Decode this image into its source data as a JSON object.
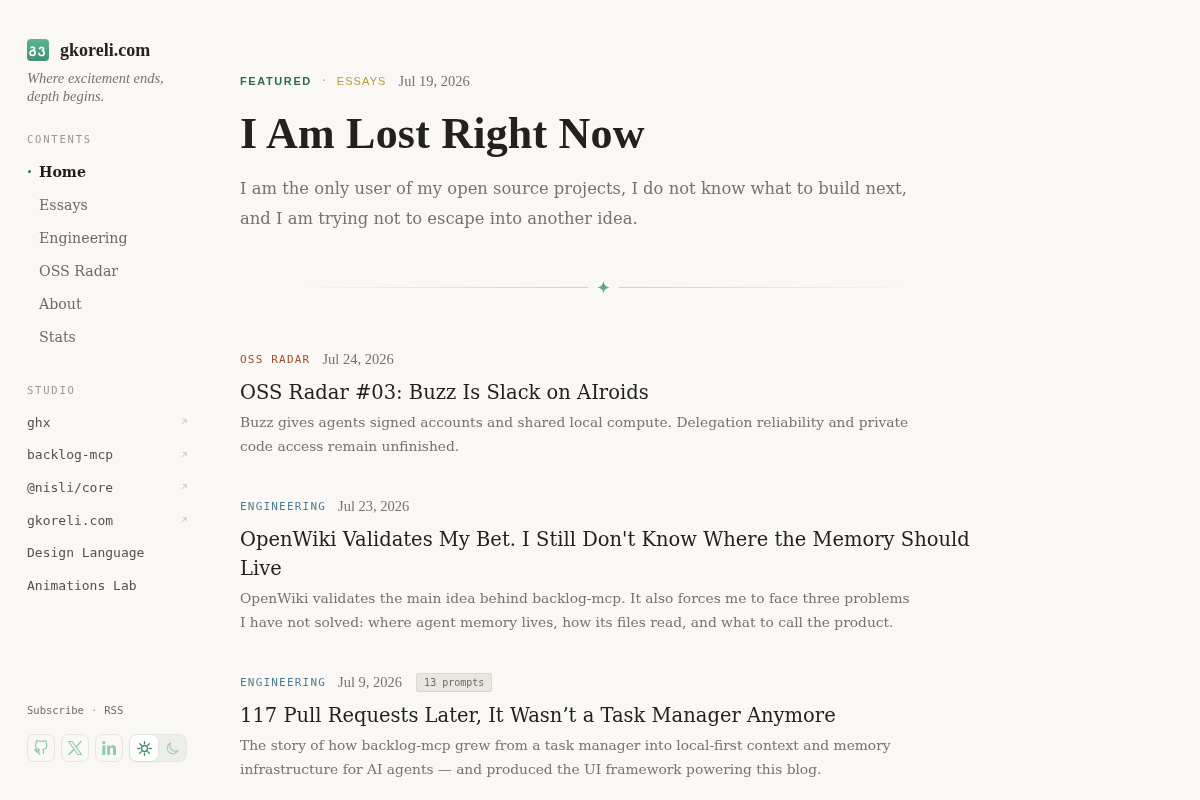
{
  "site": {
    "name": "gkoreli.com",
    "tagline": "Where excitement ends, depth begins."
  },
  "contents": {
    "heading": "CONTENTS",
    "items": [
      {
        "label": "Home",
        "selected": true
      },
      {
        "label": "Essays",
        "selected": false
      },
      {
        "label": "Engineering",
        "selected": false
      },
      {
        "label": "OSS Radar",
        "selected": false
      },
      {
        "label": "About",
        "selected": false
      },
      {
        "label": "Stats",
        "selected": false
      }
    ]
  },
  "studio": {
    "heading": "STUDIO",
    "items": [
      {
        "label": "ghx",
        "external": true
      },
      {
        "label": "backlog-mcp",
        "external": true
      },
      {
        "label": "@nisli/core",
        "external": true
      },
      {
        "label": "gkoreli.com",
        "external": true
      },
      {
        "label": "Design Language",
        "external": false
      },
      {
        "label": "Animations Lab",
        "external": false
      }
    ]
  },
  "footer": {
    "links": [
      "Subscribe",
      "RSS"
    ],
    "separator": "·"
  },
  "social": [
    {
      "kind": "github"
    },
    {
      "kind": "x"
    },
    {
      "kind": "linkedin"
    }
  ],
  "theme_toggle": [
    {
      "kind": "light",
      "selected": true
    },
    {
      "kind": "dark",
      "selected": false
    }
  ],
  "featured": {
    "label": "FEATURED",
    "separator": "·",
    "category": "ESSAYS",
    "date": "Jul 19, 2026",
    "title": "I Am Lost Right Now",
    "summary": "I am the only user of my open source projects, I do not know what to build next, and I am trying not to escape into another idea."
  },
  "posts": [
    {
      "category": "OSS RADAR",
      "color": "#a34b2e",
      "date": "Jul 24, 2026",
      "title": "OSS Radar #03: Buzz Is Slack on AIroids",
      "excerpt": "Buzz gives agents signed accounts and shared local compute. Delegation reliability and private code access remain unfinished."
    },
    {
      "category": "ENGINEERING",
      "color": "#4f7d94",
      "date": "Jul 23, 2026",
      "title": "OpenWiki Validates My Bet. I Still Don't Know Where the Memory Should Live",
      "excerpt": "OpenWiki validates the main idea behind backlog-mcp. It also forces me to face three problems I have not solved: where agent memory lives, how its files read, and what to call the product."
    },
    {
      "category": "ENGINEERING",
      "color": "#4f7d94",
      "date": "Jul 9, 2026",
      "badge": "13 prompts",
      "title": "117 Pull Requests Later, It Wasn’t a Task Manager Anymore",
      "excerpt": "The story of how backlog-mcp grew from a task manager into local-first context and memory infrastructure for AI agents — and produced the UI framework powering this blog."
    }
  ]
}
